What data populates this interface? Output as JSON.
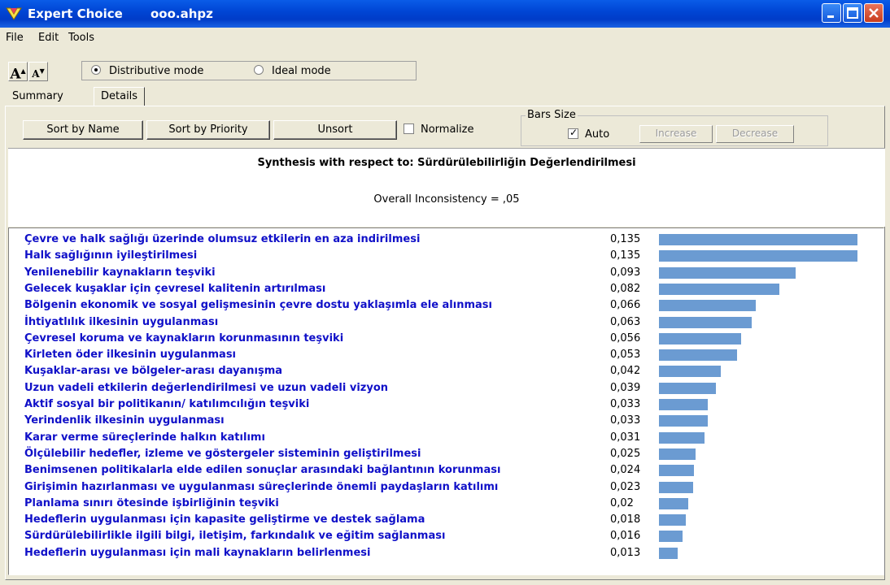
{
  "window": {
    "app_name": "Expert Choice",
    "file_name": "ooo.ahpz"
  },
  "menu": {
    "items": [
      "File",
      "Edit",
      "Tools"
    ]
  },
  "toolbar": {
    "font_larger": "A",
    "font_smaller": "A",
    "modes": {
      "distributive": "Distributive mode",
      "ideal": "Ideal mode",
      "selected": "distributive"
    }
  },
  "tabs": {
    "summary": "Summary",
    "details": "Details",
    "active": "details"
  },
  "controls": {
    "sort_by_name": "Sort by Name",
    "sort_by_priority": "Sort by Priority",
    "unsort": "Unsort",
    "normalize": "Normalize",
    "normalize_checked": false,
    "bars_size_title": "Bars Size",
    "auto": "Auto",
    "auto_checked": true,
    "increase": "Increase",
    "decrease": "Decrease"
  },
  "synthesis": {
    "title": "Synthesis with respect to: Sürdürülebilirliğin Değerlendirilmesi",
    "inconsistency": "Overall Inconsistency = ,05"
  },
  "colors": {
    "bar": "#6B9BD2",
    "label_text": "#1010C8",
    "title_bar": "#0046D5"
  },
  "chart_data": {
    "type": "bar",
    "orientation": "horizontal",
    "categories": [
      "Çevre ve halk sağlığı üzerinde olumsuz etkilerin en aza indirilmesi",
      "Halk sağlığının iyileştirilmesi",
      "Yenilenebilir kaynakların teşviki",
      "Gelecek kuşaklar için çevresel kalitenin artırılması",
      "Bölgenin ekonomik ve sosyal gelişmesinin çevre dostu yaklaşımla ele alınması",
      "İhtiyatlılık ilkesinin uygulanması",
      "Çevresel koruma ve kaynakların korunmasının teşviki",
      "Kirleten öder ilkesinin uygulanması",
      "Kuşaklar-arası ve bölgeler-arası dayanışma",
      "Uzun vadeli etkilerin değerlendirilmesi ve uzun vadeli vizyon",
      "Aktif sosyal bir politikanın/ katılımcılığın teşviki",
      "Yerindenlik ilkesinin uygulanması",
      "Karar verme süreçlerinde halkın katılımı",
      "Ölçülebilir hedefler, izleme ve göstergeler sisteminin geliştirilmesi",
      "Benimsenen politikalarla elde edilen sonuçlar arasındaki bağlantının korunması",
      "Girişimin hazırlanması ve uygulanması süreçlerinde önemli paydaşların katılımı",
      "Planlama sınırı ötesinde işbirliğinin teşviki",
      "Hedeflerin uygulanması için kapasite geliştirme ve destek sağlama",
      "Sürdürülebilirlikle ilgili bilgi, iletişim, farkındalık ve eğitim sağlanması",
      "Hedeflerin uygulanması için mali kaynakların belirlenmesi"
    ],
    "values": [
      0.135,
      0.135,
      0.093,
      0.082,
      0.066,
      0.063,
      0.056,
      0.053,
      0.042,
      0.039,
      0.033,
      0.033,
      0.031,
      0.025,
      0.024,
      0.023,
      0.02,
      0.018,
      0.016,
      0.013
    ],
    "value_labels": [
      "0,135",
      "0,135",
      "0,093",
      "0,082",
      "0,066",
      "0,063",
      "0,056",
      "0,053",
      "0,042",
      "0,039",
      "0,033",
      "0,033",
      "0,031",
      "0,025",
      "0,024",
      "0,023",
      "0,02",
      "0,018",
      "0,016",
      "0,013"
    ]
  }
}
